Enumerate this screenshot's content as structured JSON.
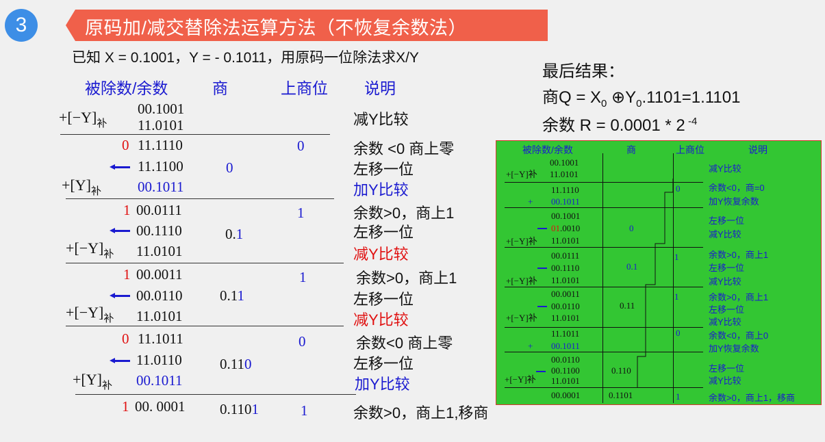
{
  "header": {
    "badge": "3",
    "title": "原码加/减交替除法运算方法（不恢复余数法）"
  },
  "problem": "已知 X = 0.1001，Y = - 0.1011，用原码一位除法求X/Y",
  "columns": {
    "dividend": "被除数/余数",
    "quotient": "商",
    "qbit": "上商位",
    "note": "说明"
  },
  "rows": [
    {
      "lbl": "+[−Y]",
      "sub": "补",
      "a": "00.1001",
      "b": "11.0101",
      "note": "减Y比较"
    },
    {
      "carry": "0",
      "val": "11.1110",
      "qbit": "0",
      "note": "余数 <0 商上零"
    },
    {
      "val": "11.1100",
      "q": "0",
      "note": "左移一位"
    },
    {
      "lbl": "+[Y]",
      "sub": "补",
      "val": "00.1011",
      "note": "加Y比较"
    },
    {
      "carry": "1",
      "val": "00.0111",
      "qbit": "1",
      "note": "余数>0，商上1"
    },
    {
      "val": "00.1110",
      "q1": "0.",
      "q2": "1",
      "note": "左移一位"
    },
    {
      "lbl": "+[−Y]",
      "sub": "补",
      "val": "11.0101",
      "note": "减Y比较"
    },
    {
      "carry": "1",
      "val": "00.0011",
      "qbit": "1",
      "note": "余数>0，商上1"
    },
    {
      "val": "00.0110",
      "q1": "0.1",
      "q2": "1",
      "note": "左移一位"
    },
    {
      "lbl": "+[−Y]",
      "sub": "补",
      "val": "11.0101",
      "note": "减Y比较"
    },
    {
      "carry": "0",
      "val": "11.1011",
      "qbit": "0",
      "note": "余数<0 商上零"
    },
    {
      "val": "11.0110",
      "q1": "0.11",
      "q2": "0",
      "note": "左移一位"
    },
    {
      "lbl": "+[Y]",
      "sub": "补",
      "val": "00.1011",
      "note": "加Y比较"
    },
    {
      "carry": "1",
      "val": "00. 0001",
      "q1": "0.110",
      "q2": "1",
      "qbit": "1",
      "note": "余数>0，商上1,移商"
    }
  ],
  "result": {
    "title": "最后结果：",
    "q_prefix": "商Q = X",
    "q_sub0": "0",
    "q_mid": " ⊕Y",
    "q_sub1": "0",
    "q_tail": ".1101=1.1101",
    "r_prefix": "余数 R = 0.0001 * 2",
    "r_exp": " -4"
  },
  "panel": {
    "headers": {
      "dividend": "被除数/余数",
      "quotient": "商",
      "qbit": "上商位",
      "note": "说明"
    },
    "items": [
      {
        "v": [
          "00.1001",
          "11.0101"
        ],
        "lbl": "+[−Y]补",
        "notes": [
          "减Y比较"
        ]
      },
      {
        "v": [
          "11.1110",
          "00.1011"
        ],
        "plus": "+",
        "qbit": "0",
        "notes": [
          "余数<0，商=0",
          "加Y恢复余数"
        ]
      },
      {
        "v": [
          "00.1001",
          "01.0010",
          "11.0101"
        ],
        "red": "01",
        "red_rest": ".0010",
        "q": "0",
        "lbl": "+[−Y]补",
        "notes": [
          "左移一位",
          "减Y比较"
        ]
      },
      {
        "v": [
          "00.0111",
          "00.1110",
          "11.0101"
        ],
        "q": "0.1",
        "qbit": "1",
        "lbl": "+[−Y]补",
        "notes": [
          "余数>0，商上1",
          "左移一位",
          "减Y比较"
        ]
      },
      {
        "v": [
          "00.0011",
          "00.0110",
          "11.0101"
        ],
        "q": "0.11",
        "qbit": "1",
        "lbl": "+[−Y]补",
        "notes": [
          "余数>0，商上1",
          "左移一位",
          "减Y比较"
        ]
      },
      {
        "v": [
          "11.1011",
          "00.1011"
        ],
        "plus": "+",
        "qbit": "0",
        "notes": [
          "余数<0，商上0",
          "加Y恢复余数"
        ]
      },
      {
        "v": [
          "00.0110",
          "00.1100",
          "11.0101"
        ],
        "q": "0.110",
        "lbl": "+[−Y]补",
        "notes": [
          "左移一位",
          "减Y比较"
        ]
      },
      {
        "v": [
          "00.0001"
        ],
        "q": "0.1101",
        "qbit": "1",
        "notes": [
          "余数>0，商上1，移商"
        ]
      }
    ]
  },
  "colors": {
    "badge": "#3d8ee6",
    "banner": "#f0604a",
    "blue": "#1a1ad0",
    "red": "#e01010",
    "panel": "#33c633"
  }
}
